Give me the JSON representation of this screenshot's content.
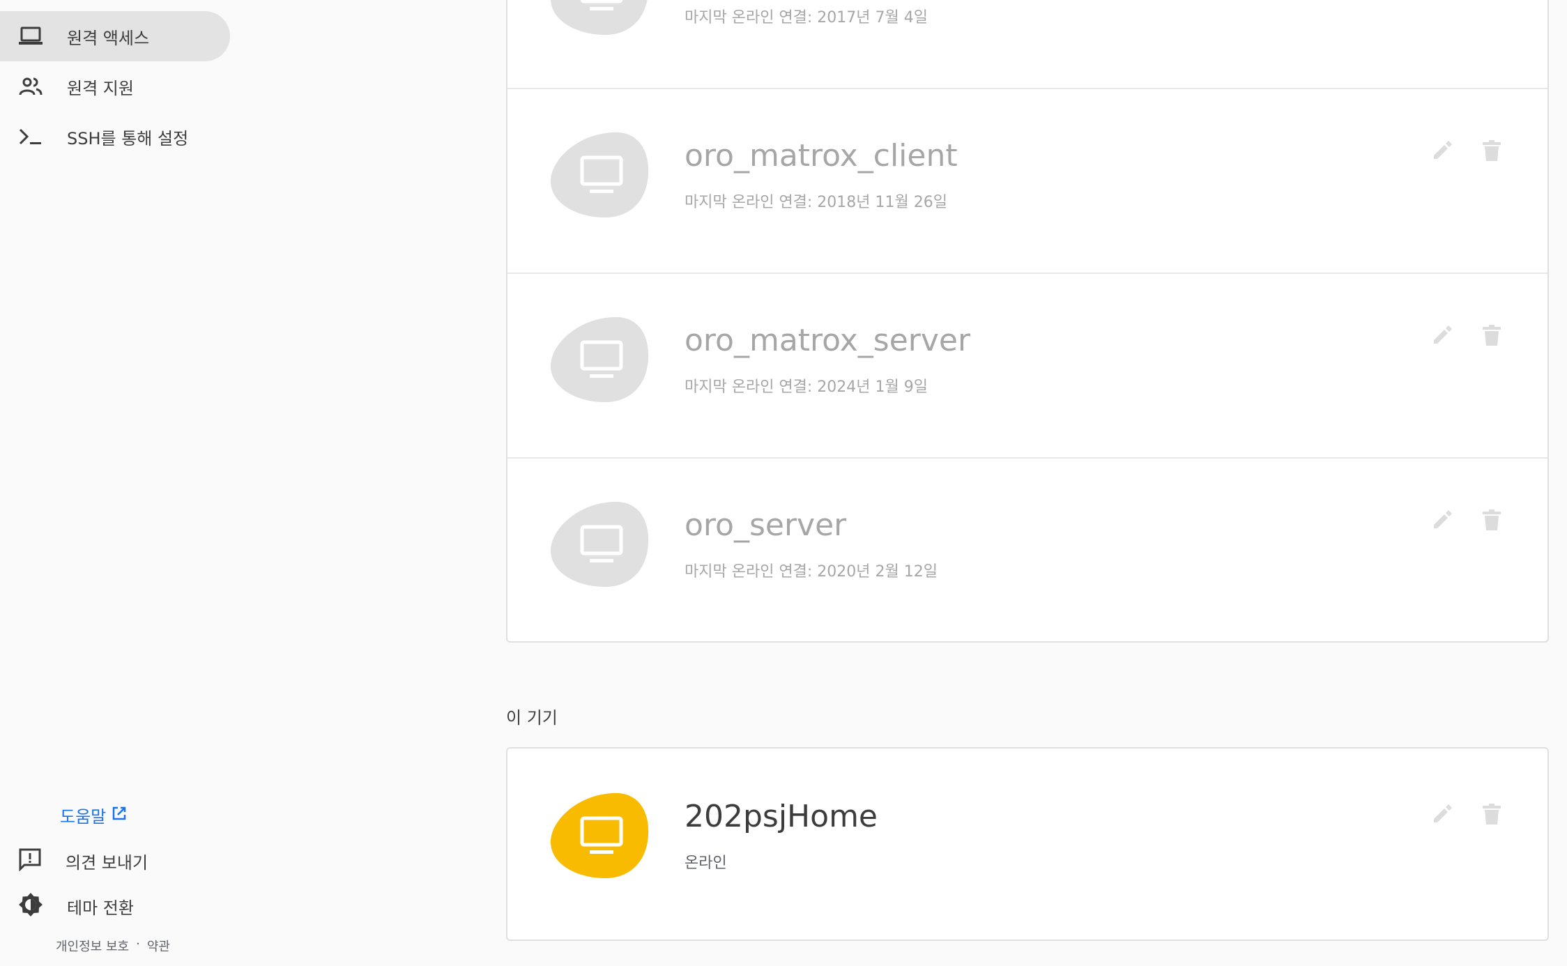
{
  "sidebar": {
    "items": [
      {
        "label": "원격 액세스",
        "icon": "laptop-icon",
        "active": true
      },
      {
        "label": "원격 지원",
        "icon": "people-icon",
        "active": false
      },
      {
        "label": "SSH를 통해 설정",
        "icon": "terminal-icon",
        "active": false
      }
    ],
    "help_label": "도움말",
    "feedback_label": "의견 보내기",
    "theme_label": "테마 전환",
    "privacy_label": "개인정보 보호",
    "separator": "·",
    "terms_label": "약관"
  },
  "remote_devices": [
    {
      "name": "",
      "status": "마지막 온라인 연결: 2017년 7월 4일"
    },
    {
      "name": "oro_matrox_client",
      "status": "마지막 온라인 연결: 2018년 11월 26일"
    },
    {
      "name": "oro_matrox_server",
      "status": "마지막 온라인 연결: 2024년 1월 9일"
    },
    {
      "name": "oro_server",
      "status": "마지막 온라인 연결: 2020년 2월 12일"
    }
  ],
  "this_device": {
    "section_label": "이 기기",
    "name": "202psjHome",
    "status": "온라인"
  },
  "colors": {
    "accent": "#1a73e8",
    "online_blob": "#f9bb00",
    "offline_blob": "#e0e0e0",
    "active_nav": "#e3e3e3"
  }
}
